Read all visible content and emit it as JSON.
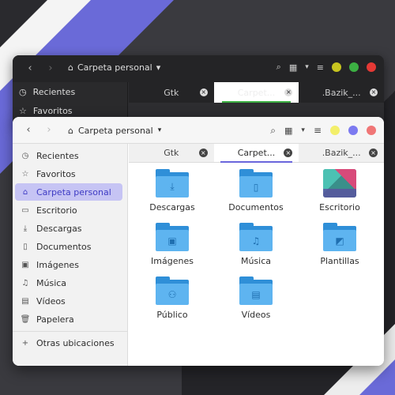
{
  "dark_window": {
    "path_label": "Carpeta personal",
    "sidebar": [
      {
        "icon": "clock-icon",
        "label": "Recientes"
      },
      {
        "icon": "star-icon",
        "label": "Favoritos"
      }
    ],
    "tabs": [
      {
        "label": "Gtk",
        "active": false
      },
      {
        "label": "Carpet...",
        "active": true
      },
      {
        "label": ".Bazik_...",
        "active": false
      }
    ],
    "window_button_colors": [
      "#c7c41f",
      "#3cb043",
      "#e53935"
    ]
  },
  "window": {
    "path_label": "Carpeta personal",
    "window_button_colors": [
      "#f3ef6a",
      "#7c7af0",
      "#f07676"
    ],
    "accent_color": "#6a66dc"
  },
  "sidebar": {
    "items": [
      {
        "icon": "clock-icon",
        "label": "Recientes",
        "selected": false
      },
      {
        "icon": "star-icon",
        "label": "Favoritos",
        "selected": false
      },
      {
        "icon": "home-icon",
        "label": "Carpeta personal",
        "selected": true
      },
      {
        "icon": "folder-icon",
        "label": "Escritorio",
        "selected": false
      },
      {
        "icon": "download-icon",
        "label": "Descargas",
        "selected": false
      },
      {
        "icon": "document-icon",
        "label": "Documentos",
        "selected": false
      },
      {
        "icon": "image-icon",
        "label": "Imágenes",
        "selected": false
      },
      {
        "icon": "music-icon",
        "label": "Música",
        "selected": false
      },
      {
        "icon": "video-icon",
        "label": "Vídeos",
        "selected": false
      },
      {
        "icon": "trash-icon",
        "label": "Papelera",
        "selected": false
      }
    ],
    "other_locations": "Otras ubicaciones"
  },
  "tabs": [
    {
      "label": "Gtk",
      "active": false
    },
    {
      "label": "Carpet...",
      "active": true
    },
    {
      "label": ".Bazik_...",
      "active": false
    }
  ],
  "files": [
    {
      "label": "Descargas",
      "icon": "download-icon"
    },
    {
      "label": "Documentos",
      "icon": "document-icon"
    },
    {
      "label": "Escritorio",
      "icon": "desktop-wallpaper-icon"
    },
    {
      "label": "Imágenes",
      "icon": "image-icon"
    },
    {
      "label": "Música",
      "icon": "music-icon"
    },
    {
      "label": "Plantillas",
      "icon": "template-icon"
    },
    {
      "label": "Público",
      "icon": "people-icon"
    },
    {
      "label": "Vídeos",
      "icon": "film-icon"
    }
  ]
}
